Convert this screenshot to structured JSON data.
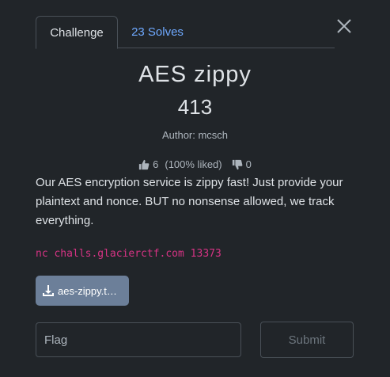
{
  "tabs": {
    "challenge_label": "Challenge",
    "solves_label": "23 Solves"
  },
  "challenge": {
    "name": "AES zippy",
    "points": "413",
    "author": "Author: mcsch",
    "likes": "6",
    "liked_percent": "(100% liked)",
    "dislikes": "0",
    "description": "Our AES encryption service is zippy fast! Just provide your plaintext and nonce. BUT no nonsense allowed, we track everything.",
    "connection": "nc challs.glacierctf.com 13373",
    "file_label": "aes-zippy.t…"
  },
  "form": {
    "flag_placeholder": "Flag",
    "submit_label": "Submit"
  },
  "icons": {
    "close": "close-icon",
    "thumbs_up": "thumbs-up-icon",
    "thumbs_down": "thumbs-down-icon",
    "download": "download-icon"
  },
  "colors": {
    "background": "#212529",
    "link": "#6ea8fe",
    "code": "#d63384",
    "file_button": "#6c7f99"
  }
}
